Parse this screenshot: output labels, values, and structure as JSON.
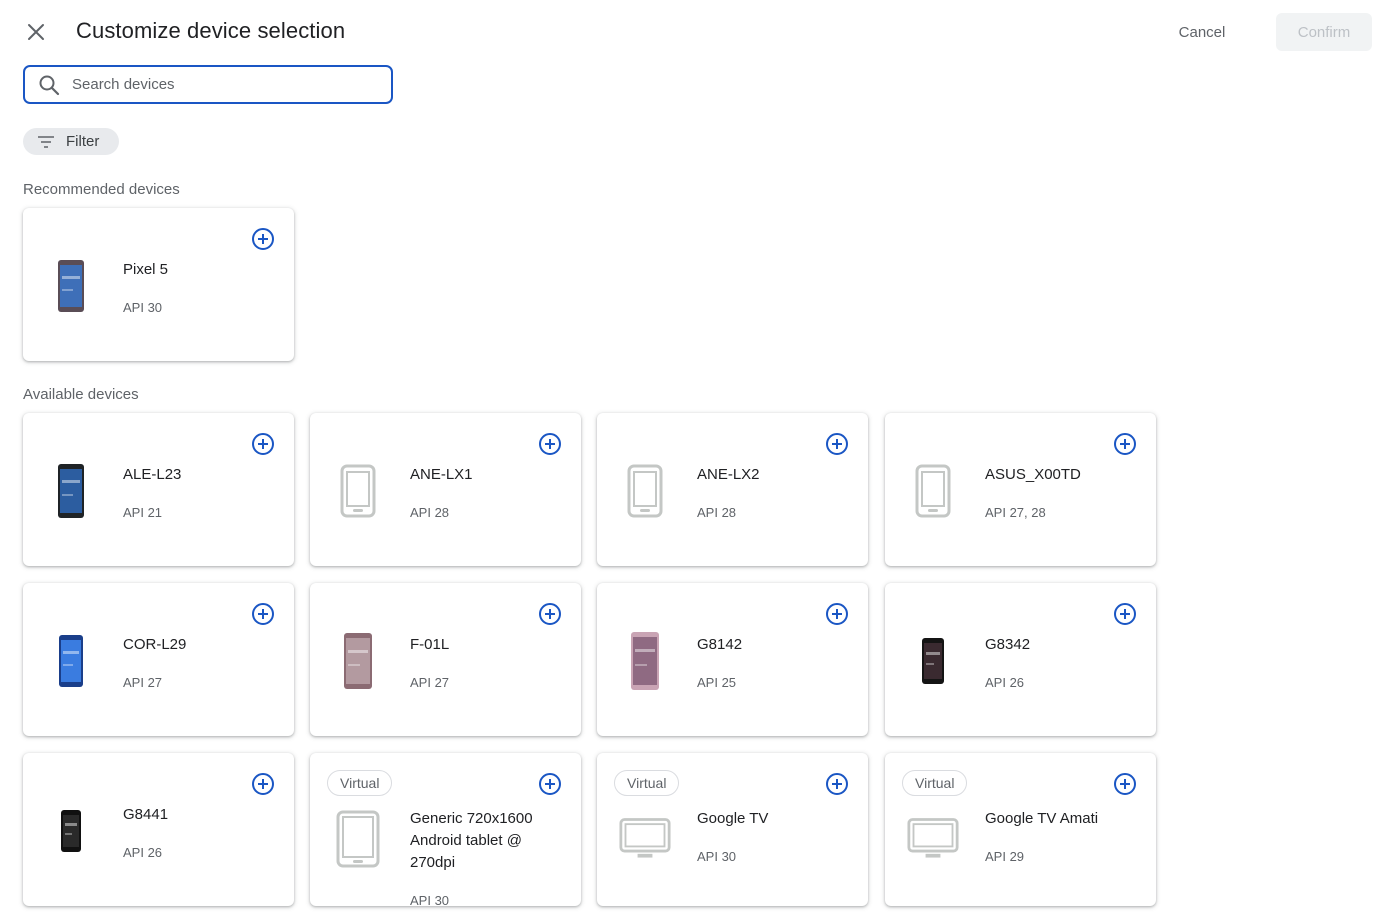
{
  "header": {
    "title": "Customize device selection",
    "cancel_label": "Cancel",
    "confirm_label": "Confirm",
    "close_icon": "close-icon"
  },
  "search": {
    "placeholder": "Search devices",
    "value": ""
  },
  "filter": {
    "label": "Filter"
  },
  "sections": {
    "recommended": "Recommended devices",
    "available": "Available devices"
  },
  "recommended_devices": [
    {
      "name": "Pixel 5",
      "api": "API 30",
      "image": "pixel5-photo",
      "virtual": ""
    }
  ],
  "available_devices": [
    {
      "name": "ALE-L23",
      "api": "API 21",
      "image": "phone-photo-dark",
      "virtual": ""
    },
    {
      "name": "ANE-LX1",
      "api": "API 28",
      "image": "phone-generic-icon",
      "virtual": ""
    },
    {
      "name": "ANE-LX2",
      "api": "API 28",
      "image": "phone-generic-icon",
      "virtual": ""
    },
    {
      "name": "ASUS_X00TD",
      "api": "API 27, 28",
      "image": "phone-generic-icon",
      "virtual": ""
    },
    {
      "name": "COR-L29",
      "api": "API 27",
      "image": "phone-photo-blue",
      "virtual": ""
    },
    {
      "name": "F-01L",
      "api": "API 27",
      "image": "phone-photo-mauve",
      "virtual": ""
    },
    {
      "name": "G8142",
      "api": "API 25",
      "image": "phone-photo-pink",
      "virtual": ""
    },
    {
      "name": "G8342",
      "api": "API 26",
      "image": "phone-photo-black",
      "virtual": ""
    },
    {
      "name": "G8441",
      "api": "API 26",
      "image": "phone-photo-black-small",
      "virtual": ""
    },
    {
      "name": "Generic 720x1600 Android tablet @ 270dpi",
      "api": "API 30",
      "image": "tablet-generic-icon",
      "virtual": "Virtual"
    },
    {
      "name": "Google TV",
      "api": "API 30",
      "image": "tv-generic-icon",
      "virtual": "Virtual"
    },
    {
      "name": "Google TV Amati",
      "api": "API 29",
      "image": "tv-generic-icon",
      "virtual": "Virtual"
    }
  ],
  "colors": {
    "accent": "#1a56c4",
    "text": "#202124",
    "secondary_text": "#5f6368",
    "generic_icon": "#c4c7c5"
  }
}
